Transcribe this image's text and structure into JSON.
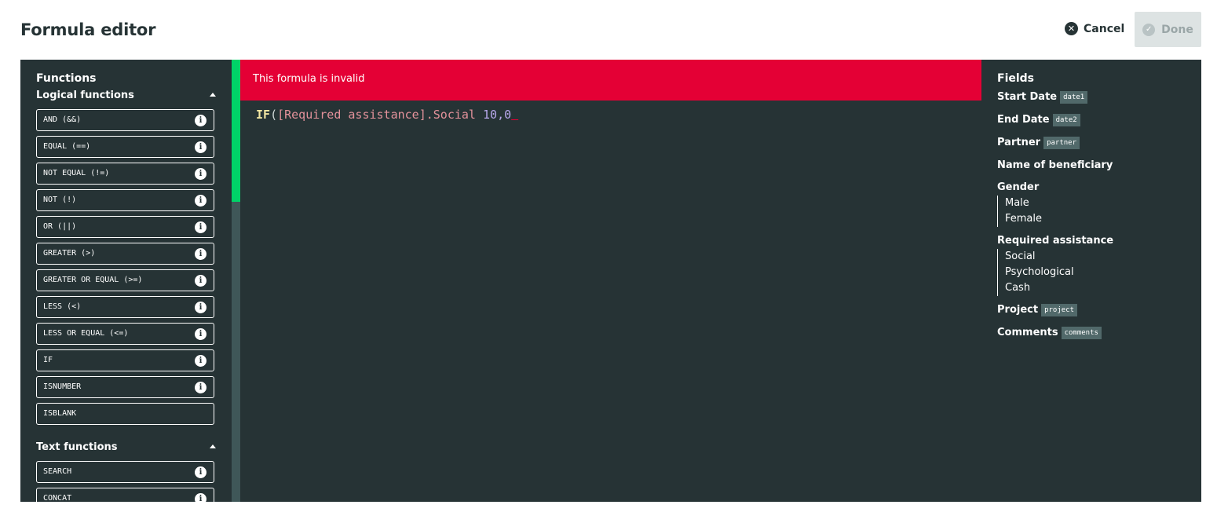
{
  "header": {
    "title": "Formula editor",
    "cancel_label": "Cancel",
    "done_label": "Done"
  },
  "functions": {
    "title": "Functions",
    "groups": [
      {
        "label": "Logical functions",
        "items": [
          {
            "label": "AND (&&)",
            "info": true
          },
          {
            "label": "EQUAL (==)",
            "info": true
          },
          {
            "label": "NOT EQUAL (!=)",
            "info": true
          },
          {
            "label": "NOT (!)",
            "info": true
          },
          {
            "label": "OR (||)",
            "info": true
          },
          {
            "label": "GREATER (>)",
            "info": true
          },
          {
            "label": "GREATER OR EQUAL (>=)",
            "info": true
          },
          {
            "label": "LESS (<)",
            "info": true
          },
          {
            "label": "LESS OR EQUAL (<=)",
            "info": true
          },
          {
            "label": "IF",
            "info": true
          },
          {
            "label": "ISNUMBER",
            "info": true
          },
          {
            "label": "ISBLANK",
            "info": false
          }
        ]
      },
      {
        "label": "Text functions",
        "items": [
          {
            "label": "SEARCH",
            "info": true
          },
          {
            "label": "CONCAT",
            "info": true
          }
        ]
      }
    ]
  },
  "editor": {
    "error_message": "This formula is invalid",
    "tokens": {
      "fn": "IF",
      "open_paren": "(",
      "field": "[Required assistance].Social",
      "space": " ",
      "num1": "10",
      "comma": ",",
      "num2": "0",
      "error_marker": " "
    }
  },
  "fields": {
    "title": "Fields",
    "items": [
      {
        "label": "Start Date",
        "tag": "date1"
      },
      {
        "label": "End Date",
        "tag": "date2"
      },
      {
        "label": "Partner",
        "tag": "partner"
      },
      {
        "label": "Name of beneficiary"
      },
      {
        "label": "Gender",
        "options": [
          "Male",
          "Female"
        ]
      },
      {
        "label": "Required assistance",
        "options": [
          "Social",
          "Psychological",
          "Cash"
        ]
      },
      {
        "label": "Project",
        "tag": "project"
      },
      {
        "label": "Comments",
        "tag": "comments"
      }
    ]
  },
  "colors": {
    "panel_bg": "#263335",
    "error_banner": "#e40035",
    "scroll_thumb": "#00d368",
    "done_disabled_bg": "#dde3e3"
  },
  "icons": {
    "cancel": "close-circle-icon",
    "done": "check-circle-icon",
    "info": "info-icon",
    "collapse": "chevron-up-icon"
  }
}
